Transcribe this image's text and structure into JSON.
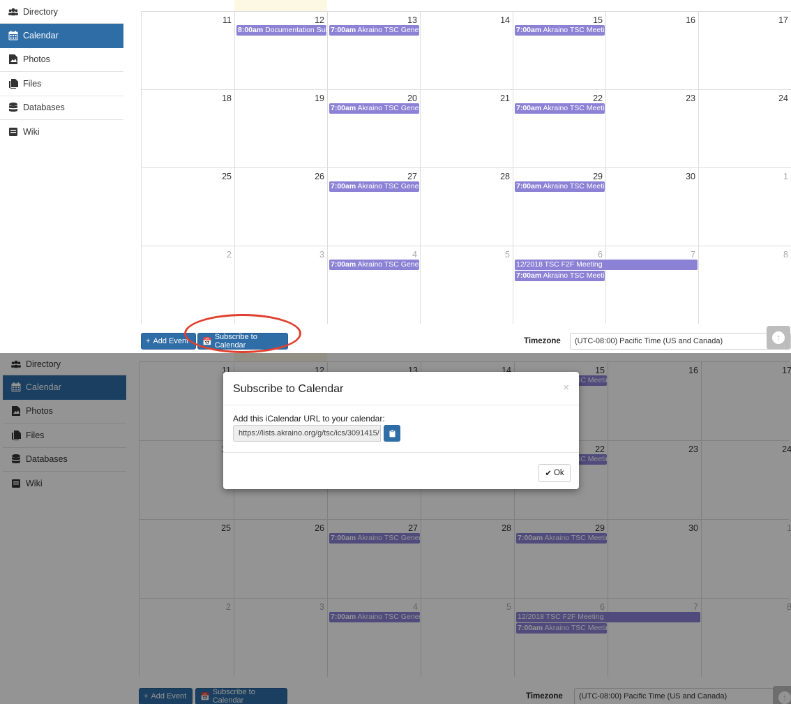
{
  "sidebar": {
    "items": [
      {
        "label": "Directory",
        "icon": "users-icon",
        "active": false
      },
      {
        "label": "Calendar",
        "icon": "calendar-icon",
        "active": true
      },
      {
        "label": "Photos",
        "icon": "photo-icon",
        "active": false
      },
      {
        "label": "Files",
        "icon": "files-icon",
        "active": false
      },
      {
        "label": "Databases",
        "icon": "database-icon",
        "active": false
      },
      {
        "label": "Wiki",
        "icon": "wiki-icon",
        "active": false
      }
    ]
  },
  "calendar": {
    "weeks": [
      {
        "days": [
          "11",
          "12",
          "13",
          "14",
          "15",
          "16",
          "17"
        ],
        "other": [
          false,
          false,
          false,
          false,
          false,
          false,
          false
        ]
      },
      {
        "days": [
          "18",
          "19",
          "20",
          "21",
          "22",
          "23",
          "24"
        ],
        "other": [
          false,
          false,
          false,
          false,
          false,
          false,
          false
        ]
      },
      {
        "days": [
          "25",
          "26",
          "27",
          "28",
          "29",
          "30",
          "1"
        ],
        "other": [
          false,
          false,
          false,
          false,
          false,
          false,
          true
        ]
      },
      {
        "days": [
          "2",
          "3",
          "4",
          "5",
          "6",
          "7",
          "8"
        ],
        "other": [
          true,
          true,
          true,
          true,
          true,
          true,
          true
        ]
      }
    ],
    "events": {
      "doc_time": "8:00am",
      "doc_title": "Documentation Sub",
      "general_time": "7:00am",
      "general_title": "Akraino TSC Genera",
      "meeting_time": "7:00am",
      "meeting_title": "Akraino TSC Meetin",
      "f2f_title": "12/2018 TSC F2F Meeting"
    },
    "event_color": "#8b82d6"
  },
  "toolbar": {
    "add_event_label": "Add Event",
    "subscribe_label": "Subscribe to Calendar",
    "timezone_label": "Timezone",
    "timezone_value": "(UTC-08:00) Pacific Time (US and Canada)",
    "button_color": "#2f6da7"
  },
  "modal": {
    "title": "Subscribe to Calendar",
    "close": "×",
    "body_text": "Add this iCalendar URL to your calendar:",
    "url": "https://lists.akraino.org/g/tsc/ics/3091415/",
    "ok_label": "Ok"
  },
  "annotation": {
    "color": "#e0412f"
  }
}
